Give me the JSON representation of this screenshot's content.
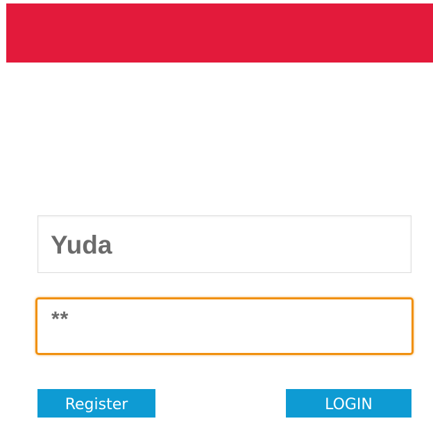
{
  "header": {
    "color": "#e31a3b"
  },
  "login_form": {
    "username": {
      "value": "Yuda"
    },
    "password": {
      "value": "**"
    },
    "register_label": "Register",
    "login_label": "LOGIN"
  },
  "colors": {
    "focus_border": "#f0900f",
    "button": "#0e9bd3"
  }
}
